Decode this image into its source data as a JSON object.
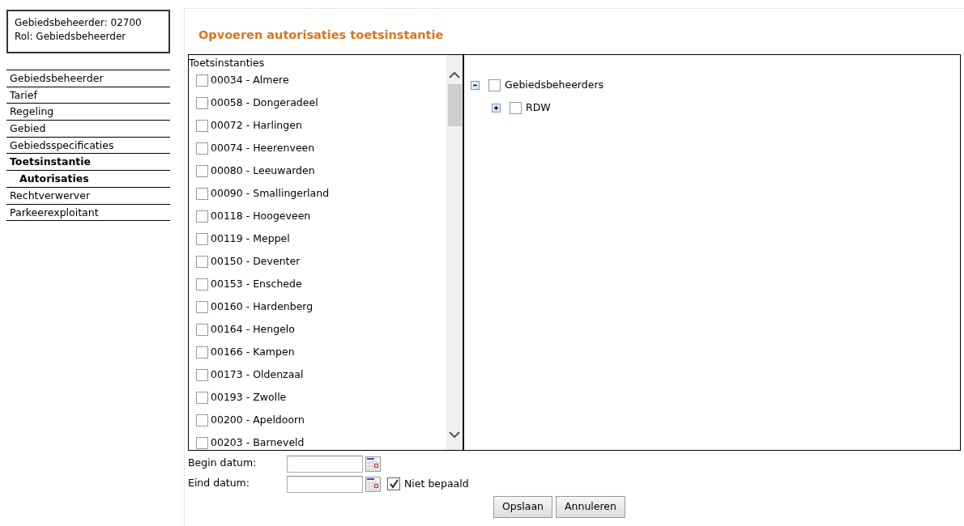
{
  "user_info": {
    "lines": [
      "Gebiedsbeheerder: 02700",
      "Rol: Gebiedsbeheerder"
    ]
  },
  "menu": [
    {
      "label": "Gebiedsbeheerder",
      "selected": false
    },
    {
      "label": "Tarief",
      "selected": false
    },
    {
      "label": "Regeling",
      "selected": false
    },
    {
      "label": "Gebied",
      "selected": false
    },
    {
      "label": "Gebiedsspecificaties",
      "selected": false
    },
    {
      "label": "Toetsinstantie",
      "selected": true,
      "children": [
        {
          "label": "Autorisaties",
          "selected": true
        }
      ]
    },
    {
      "label": "Rechtverwerver",
      "selected": false
    },
    {
      "label": "Parkeerexploitant",
      "selected": false
    }
  ],
  "page_title": "Opvoeren autorisaties toetsinstantie",
  "list": {
    "heading": "Toetsinstanties",
    "items": [
      {
        "label": "00034 - Almere",
        "checked": false
      },
      {
        "label": "00058 - Dongeradeel",
        "checked": false
      },
      {
        "label": "00072 - Harlingen",
        "checked": false
      },
      {
        "label": "00074 - Heerenveen",
        "checked": false
      },
      {
        "label": "00080 - Leeuwarden",
        "checked": false
      },
      {
        "label": "00090 - Smallingerland",
        "checked": false
      },
      {
        "label": "00118 - Hoogeveen",
        "checked": false
      },
      {
        "label": "00119 - Meppel",
        "checked": false
      },
      {
        "label": "00150 - Deventer",
        "checked": false
      },
      {
        "label": "00153 - Enschede",
        "checked": false
      },
      {
        "label": "00160 - Hardenberg",
        "checked": false
      },
      {
        "label": "00164 - Hengelo",
        "checked": false
      },
      {
        "label": "00166 - Kampen",
        "checked": false
      },
      {
        "label": "00173 - Oldenzaal",
        "checked": false
      },
      {
        "label": "00193 - Zwolle",
        "checked": false
      },
      {
        "label": "00200 - Apeldoorn",
        "checked": false
      },
      {
        "label": "00203 - Barneveld",
        "checked": false
      }
    ]
  },
  "tree": [
    {
      "label": "Gebiedsbeheerders",
      "checked": false,
      "expanded": true,
      "children": [
        {
          "label": "RDW",
          "checked": false,
          "expanded": false
        }
      ]
    }
  ],
  "form": {
    "begin_label": "Begin datum:",
    "end_label": "Eind datum:",
    "not_set": {
      "label": "Niet bepaald",
      "checked": true
    }
  },
  "buttons": [
    "Opslaan",
    "Annuleren"
  ]
}
